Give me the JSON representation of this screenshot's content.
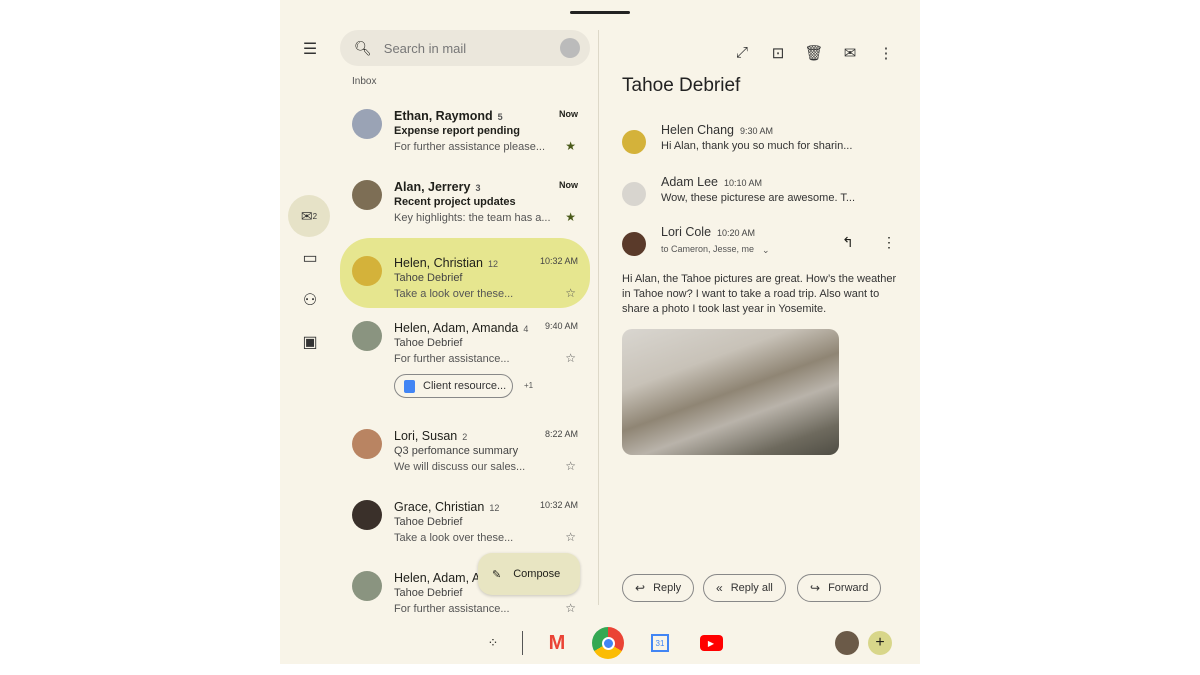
{
  "search": {
    "placeholder": "Search in mail"
  },
  "inbox_label": "Inbox",
  "rail": {
    "mail_badge": "2"
  },
  "threads": [
    {
      "name": "Ethan, Raymond",
      "count": "5",
      "time": "Now",
      "subject": "Expense report pending",
      "preview": "For further assistance please...",
      "starred": true,
      "unread": true,
      "avatar_color": "#9aa3b5"
    },
    {
      "name": "Alan, Jerrery",
      "count": "3",
      "time": "Now",
      "subject": "Recent project updates",
      "preview": "Key highlights: the team has a...",
      "starred": true,
      "unread": true,
      "avatar_color": "#7d6e55"
    },
    {
      "name": "Helen, Christian",
      "count": "12",
      "time": "10:32 AM",
      "subject": "Tahoe Debrief",
      "preview": "Take a look over these...",
      "starred": false,
      "selected": true,
      "avatar_color": "#d4b23a"
    },
    {
      "name": "Helen, Adam, Amanda",
      "count": "4",
      "time": "9:40 AM",
      "subject": "Tahoe Debrief",
      "preview": "For further assistance...",
      "starred": false,
      "avatar_color": "#8a9480",
      "attachment": "Client resource...",
      "attachment_more": "+1"
    },
    {
      "name": "Lori, Susan",
      "count": "2",
      "time": "8:22 AM",
      "subject": "Q3 perfomance summary",
      "preview": "We will discuss our sales...",
      "starred": false,
      "avatar_color": "#b98462"
    },
    {
      "name": "Grace, Christian",
      "count": "12",
      "time": "10:32 AM",
      "subject": "Tahoe Debrief",
      "preview": "Take a look over these...",
      "starred": false,
      "avatar_color": "#3a302a"
    },
    {
      "name": "Helen, Adam, Ar",
      "count": "",
      "time": "",
      "subject": "Tahoe Debrief",
      "preview": "For further assistance...",
      "starred": false,
      "avatar_color": "#8a9480"
    }
  ],
  "compose_label": "Compose",
  "detail": {
    "title": "Tahoe Debrief",
    "messages": [
      {
        "from": "Helen Chang",
        "time": "9:30 AM",
        "snippet": "Hi Alan, thank you so much for sharin...",
        "avatar_color": "#d4b23a"
      },
      {
        "from": "Adam Lee",
        "time": "10:10 AM",
        "snippet": "Wow, these picturese are awesome. T...",
        "avatar_color": "#d8d5cf"
      },
      {
        "from": "Lori Cole",
        "time": "10:20 AM",
        "snippet": "to Cameron, Jesse, me",
        "avatar_color": "#5a3a2a"
      }
    ],
    "body": "Hi Alan, the Tahoe pictures are great. How’s the weather in Tahoe now? I want to take a road trip. Also want to share a photo I took last year in Yosemite.",
    "reply_label": "Reply",
    "reply_all_label": "Reply all",
    "forward_label": "Forward"
  },
  "taskbar": {
    "calendar_day": "31"
  },
  "colors": {
    "background": "#f8f4e8",
    "selected_row": "#e6e68f",
    "accent": "#4a5a1a"
  }
}
